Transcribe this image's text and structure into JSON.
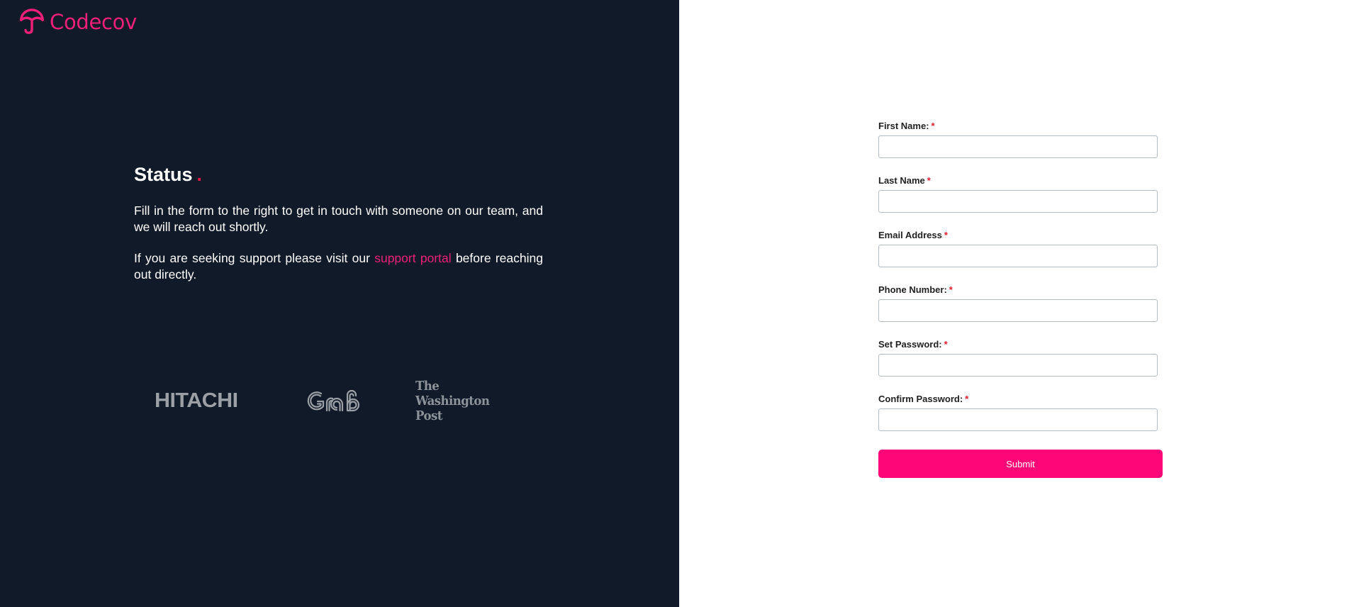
{
  "brand": {
    "name": "Codecov",
    "accent_color": "#f01f7a",
    "logo_icon": "umbrella-logo-icon"
  },
  "intro": {
    "heading": "Status",
    "heading_dot": ".",
    "paragraph1": "Fill in the form to the right to get in touch with someone on our team, and we will reach out shortly.",
    "paragraph2_before": "If you are seeking support please visit our ",
    "paragraph2_link": "support portal",
    "paragraph2_after": " before reaching out directly."
  },
  "customer_logos": [
    "HITACHI",
    "Grab",
    "The Washington Post"
  ],
  "form": {
    "required_marker": "*",
    "fields": [
      {
        "label": "First Name:",
        "value": "",
        "placeholder": ""
      },
      {
        "label": "Last Name",
        "value": "",
        "placeholder": ""
      },
      {
        "label": "Email Address",
        "value": "",
        "placeholder": ""
      },
      {
        "label": "Phone Number:",
        "value": "",
        "placeholder": ""
      },
      {
        "label": "Set Password:",
        "value": "",
        "placeholder": ""
      },
      {
        "label": "Confirm Password:",
        "value": "",
        "placeholder": ""
      }
    ],
    "submit_label": "Submit",
    "submit_color": "#ff0678"
  },
  "colors": {
    "left_panel_bg": "#101a28",
    "required_color": "#e0202e"
  }
}
